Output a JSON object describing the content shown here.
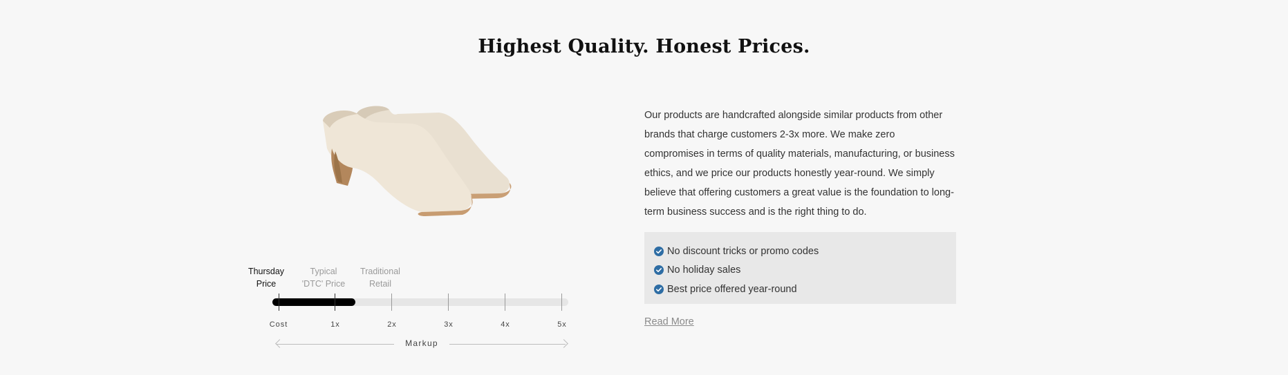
{
  "heading": "Highest Quality. Honest Prices.",
  "product_image": {
    "icon": "mule-shoes-image",
    "colors": {
      "leather": "#ede4d5",
      "heel": "#b88e64",
      "sole": "#caa47c"
    }
  },
  "price_meter": {
    "tiers": [
      {
        "line1": "Thursday",
        "line2": "Price"
      },
      {
        "line1": "Typical",
        "line2": "'DTC' Price"
      },
      {
        "line1": "Traditional",
        "line2": "Retail"
      }
    ],
    "scale_labels": [
      "Cost",
      "1x",
      "2x",
      "3x",
      "4x",
      "5x"
    ],
    "markup_label": "Markup",
    "thursday_markup": 1.35,
    "scale_max": 5
  },
  "description": "Our products are handcrafted alongside similar products from other brands that charge customers 2-3x more. We make zero compromises in terms of quality materials, manufacturing, or business ethics, and we price our products honestly year-round. We simply believe that offering customers a great value is the foundation to long-term business success and is the right thing to do.",
  "benefits": {
    "items": [
      "No discount tricks or promo codes",
      "No holiday sales",
      "Best price offered year-round"
    ],
    "check_color": "#2e6da4"
  },
  "read_more": "Read More"
}
